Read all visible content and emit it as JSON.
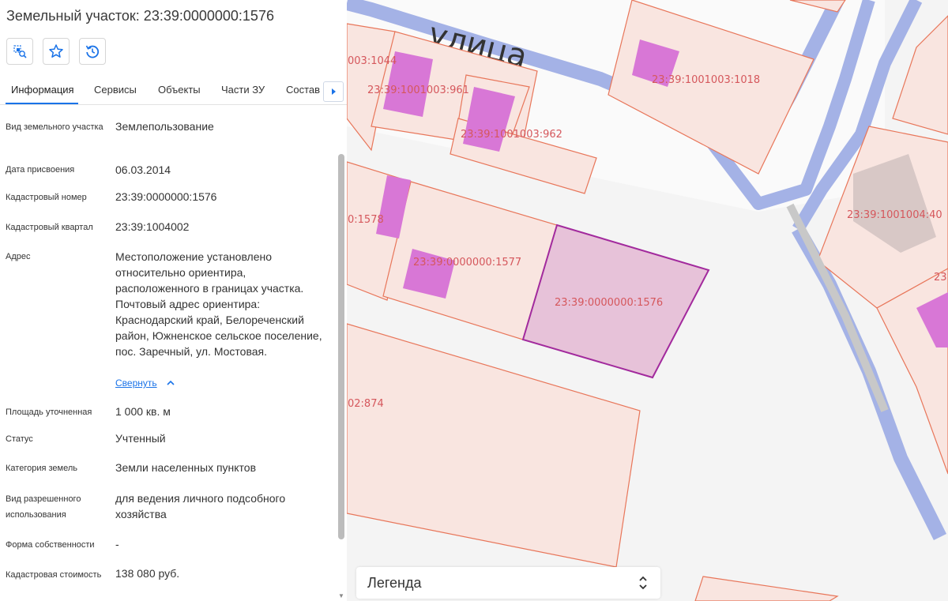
{
  "panel": {
    "title": "Земельный участок: 23:39:0000000:1576",
    "tools": [
      "select-parcel-icon",
      "star-icon",
      "history-icon"
    ],
    "tabs": [
      {
        "label": "Информация",
        "active": true
      },
      {
        "label": "Сервисы"
      },
      {
        "label": "Объекты"
      },
      {
        "label": "Части ЗУ"
      },
      {
        "label": "Состав"
      }
    ],
    "fields": [
      {
        "label": "Вид земельного участка",
        "value": "Землепользование"
      },
      {
        "label": "Дата присвоения",
        "value": "06.03.2014"
      },
      {
        "label": "Кадастровый номер",
        "value": "23:39:0000000:1576"
      },
      {
        "label": "Кадастровый квартал",
        "value": "23:39:1004002"
      },
      {
        "label": "Адрес",
        "value": "Местоположение установлено относительно ориентира, расположенного в границах участка. Почтовый адрес ориентира: Краснодарский край, Белореченский район, Южненское сельское поселение, пос. Заречный, ул. Мостовая."
      },
      {
        "label": "Площадь уточненная",
        "value": "1 000 кв. м"
      },
      {
        "label": "Статус",
        "value": "Учтенный"
      },
      {
        "label": "Категория земель",
        "value": "Земли населенных пунктов"
      },
      {
        "label": "Вид разрешенного использования",
        "value": "для ведения личного подсобного хозяйства"
      },
      {
        "label": "Форма собственности",
        "value": "-"
      },
      {
        "label": "Кадастровая стоимость",
        "value": "138 080 руб."
      }
    ],
    "collapse_link": "Свернуть"
  },
  "map": {
    "street_label": "улица",
    "parcel_labels": [
      "003:1044",
      "23:39:1001003:961",
      "23:39:1001003:962",
      "23:39:1001003:1018",
      "23:39:1001004:40",
      "0:1578",
      "23:39:0000000:1577",
      "23:39:0000000:1576",
      "02:874",
      "23"
    ],
    "legend_label": "Легенда",
    "colors": {
      "parcel_fill": "#f9e5e0",
      "parcel_border": "#e8765a",
      "building_fill": "#d877d6",
      "selected_fill": "#e7c2d9",
      "selected_border": "#a22a9d",
      "river": "#a4b2e6",
      "label": "#d5575c",
      "accent": "#1a73e8"
    }
  }
}
